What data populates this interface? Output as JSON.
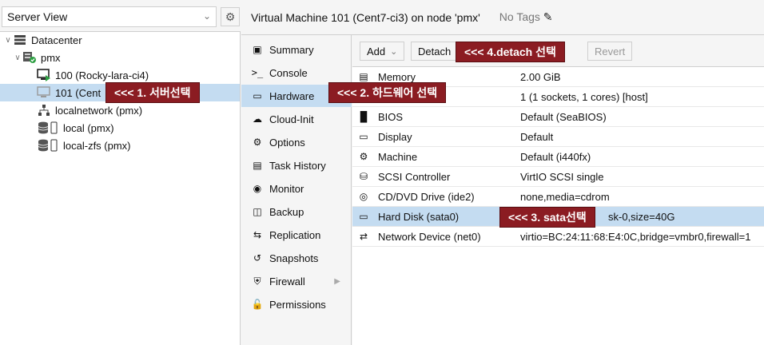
{
  "left_panel": {
    "view_select": "Server View",
    "tree": [
      {
        "label": "Datacenter",
        "icon": "datacenter-icon"
      },
      {
        "label": "pmx",
        "icon": "node-online-icon"
      },
      {
        "label": "100 (Rocky-lara-ci4)",
        "icon": "vm-running-icon"
      },
      {
        "label": "101 (Cent",
        "icon": "vm-stopped-icon"
      },
      {
        "label": "localnetwork (pmx)",
        "icon": "network-icon"
      },
      {
        "label": "local (pmx)",
        "icon": "storage-icon"
      },
      {
        "label": "local-zfs (pmx)",
        "icon": "storage-icon"
      }
    ]
  },
  "header": {
    "title": "Virtual Machine 101 (Cent7-ci3) on node 'pmx'",
    "tags": "No Tags"
  },
  "nav": [
    {
      "label": "Summary",
      "icon": "book-icon"
    },
    {
      "label": "Console",
      "icon": "terminal-icon"
    },
    {
      "label": "Hardware",
      "icon": "desktop-icon"
    },
    {
      "label": "Cloud-Init",
      "icon": "cloud-icon"
    },
    {
      "label": "Options",
      "icon": "gear-icon"
    },
    {
      "label": "Task History",
      "icon": "list-icon"
    },
    {
      "label": "Monitor",
      "icon": "eye-icon"
    },
    {
      "label": "Backup",
      "icon": "floppy-icon"
    },
    {
      "label": "Replication",
      "icon": "retweet-icon"
    },
    {
      "label": "Snapshots",
      "icon": "history-icon"
    },
    {
      "label": "Firewall",
      "icon": "shield-icon"
    },
    {
      "label": "Permissions",
      "icon": "unlock-icon"
    }
  ],
  "toolbar": {
    "add": "Add",
    "detach": "Detach",
    "revert": "Revert"
  },
  "hardware": [
    {
      "name": "Memory",
      "value": "2.00 GiB",
      "icon": "memory-icon"
    },
    {
      "name": "",
      "value": "1 (1 sockets, 1 cores) [host]",
      "icon": "cpu-icon"
    },
    {
      "name": "BIOS",
      "value": "Default (SeaBIOS)",
      "icon": "chip-icon"
    },
    {
      "name": "Display",
      "value": "Default",
      "icon": "display-icon"
    },
    {
      "name": "Machine",
      "value": "Default (i440fx)",
      "icon": "cogs-icon"
    },
    {
      "name": "SCSI Controller",
      "value": "VirtIO SCSI single",
      "icon": "database-icon"
    },
    {
      "name": "CD/DVD Drive (ide2)",
      "value": "none,media=cdrom",
      "icon": "cdrom-icon"
    },
    {
      "name": "Hard Disk (sata0)",
      "value": "sk-0,size=40G",
      "icon": "hdd-icon"
    },
    {
      "name": "Network Device (net0)",
      "value": "virtio=BC:24:11:68:E4:0C,bridge=vmbr0,firewall=1",
      "icon": "exchange-icon"
    }
  ],
  "annotations": {
    "a1": "<<< 1. 서버선택",
    "a2": "<<< 2. 하드웨어 선택",
    "a3": "<<< 3. sata선택",
    "a4": "<<< 4.detach 선택"
  },
  "colors": {
    "selection": "#c4dcf1",
    "annotation": "#8b1c22"
  }
}
